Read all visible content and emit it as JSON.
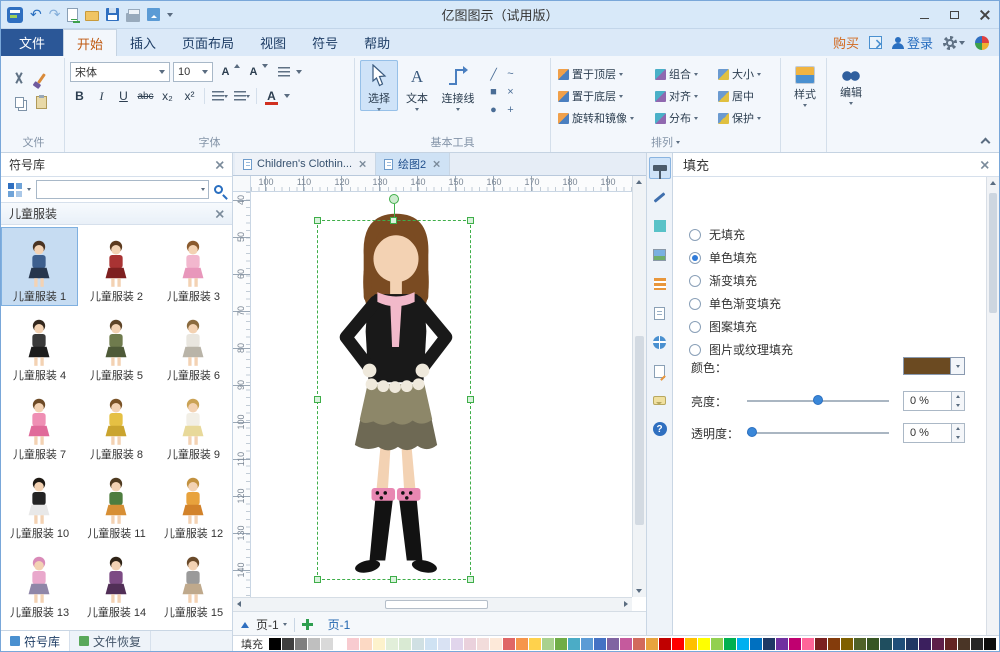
{
  "window": {
    "title": "亿图图示（试用版）"
  },
  "ribbon": {
    "file_tab": "文件",
    "tabs": [
      {
        "label": "开始",
        "active": true
      },
      {
        "label": "插入"
      },
      {
        "label": "页面布局"
      },
      {
        "label": "视图"
      },
      {
        "label": "符号"
      },
      {
        "label": "帮助"
      }
    ],
    "right": {
      "buy": "购买",
      "login": "登录"
    },
    "groups": {
      "file": {
        "label": "文件"
      },
      "font": {
        "label": "字体",
        "font_name": "宋体",
        "font_size": "10",
        "bold": "B",
        "italic": "I",
        "underline": "U",
        "strike": "abc",
        "subscript": "x₂",
        "superscript": "x²",
        "color": "A"
      },
      "tools": {
        "label": "基本工具",
        "select": "选择",
        "text": "文本",
        "connector": "连接线"
      },
      "arrange": {
        "label": "排列",
        "buttons": [
          {
            "label": "置于顶层",
            "caret": true
          },
          {
            "label": "组合",
            "caret": true
          },
          {
            "label": "大小",
            "caret": true
          },
          {
            "label": "置于底层",
            "caret": true
          },
          {
            "label": "对齐",
            "caret": true
          },
          {
            "label": "居中",
            "caret": false
          },
          {
            "label": "旋转和镜像",
            "caret": true
          },
          {
            "label": "分布",
            "caret": true
          },
          {
            "label": "保护",
            "caret": true
          }
        ]
      },
      "style": {
        "label": "样式"
      },
      "edit": {
        "label": "编辑"
      }
    }
  },
  "library": {
    "title": "符号库",
    "search_placeholder": "",
    "category": "儿童服装",
    "items": [
      {
        "label": "儿童服装 1",
        "selected": true,
        "hair": "#4a3322",
        "top": "#3d5f8e",
        "bottom": "#26364d"
      },
      {
        "label": "儿童服装 2",
        "hair": "#5d3a1e",
        "top": "#a93333",
        "bottom": "#7e2020"
      },
      {
        "label": "儿童服装 3",
        "hair": "#8a5a2e",
        "top": "#f2b7ce",
        "bottom": "#e897bb"
      },
      {
        "label": "儿童服装 4",
        "hair": "#33271d",
        "top": "#3a3a3a",
        "bottom": "#1d1d1d"
      },
      {
        "label": "儿童服装 5",
        "hair": "#5d4326",
        "top": "#6f7b4d",
        "bottom": "#4e5a38"
      },
      {
        "label": "儿童服装 6",
        "hair": "#8a6a3e",
        "top": "#e9e6df",
        "bottom": "#b9b4a8"
      },
      {
        "label": "儿童服装 7",
        "hair": "#6d4a26",
        "top": "#ef8fb4",
        "bottom": "#e06a9a"
      },
      {
        "label": "儿童服装 8",
        "hair": "#7a5226",
        "top": "#e5c043",
        "bottom": "#caa42e"
      },
      {
        "label": "儿童服装 9",
        "hair": "#caa255",
        "top": "#f2efe6",
        "bottom": "#e8d99a"
      },
      {
        "label": "儿童服装 10",
        "hair": "#1f1a14",
        "top": "#242424",
        "bottom": "#e8e8e8"
      },
      {
        "label": "儿童服装 11",
        "hair": "#4f3a20",
        "top": "#4e7d3f",
        "bottom": "#d78f35"
      },
      {
        "label": "儿童服装 12",
        "hair": "#c2913f",
        "top": "#e8a23c",
        "bottom": "#d2822a"
      },
      {
        "label": "儿童服装 13",
        "hair": "#d98ab8",
        "top": "#e9a8cc",
        "bottom": "#8f86a8"
      },
      {
        "label": "儿童服装 14",
        "hair": "#2f2316",
        "top": "#7c4a84",
        "bottom": "#512f57"
      },
      {
        "label": "儿童服装 15",
        "hair": "#6a4a2a",
        "top": "#9a9a9a",
        "bottom": "#bfa98c"
      }
    ],
    "bottom_tabs": [
      {
        "label": "符号库",
        "active": true
      },
      {
        "label": "文件恢复",
        "active": false
      }
    ]
  },
  "canvas": {
    "doc_tabs": [
      {
        "label": "Children's Clothin...",
        "active": false
      },
      {
        "label": "绘图2",
        "active": true
      }
    ],
    "ruler_h": [
      "100",
      "110",
      "120",
      "130",
      "140",
      "150",
      "160",
      "170",
      "180",
      "190"
    ],
    "ruler_v": [
      "40",
      "50",
      "60",
      "70",
      "80",
      "90",
      "100",
      "110",
      "120",
      "130",
      "140"
    ],
    "figure": {
      "hair": "#7a4b22",
      "skin": "#f3d2b3",
      "jacket": "#191919",
      "scarf": "#f2b9ca",
      "trim": "#efe9dc",
      "skirt_top": "#8d8769",
      "skirt_bottom": "#6e6954",
      "boots": "#121212",
      "boot_trim": "#e887b2",
      "selection": "#3fae49"
    },
    "page_bar": {
      "page_dropdown": "页-1",
      "page_tab": "页-1"
    }
  },
  "fill_panel": {
    "title": "填充",
    "options": [
      {
        "label": "无填充",
        "selected": false
      },
      {
        "label": "单色填充",
        "selected": true
      },
      {
        "label": "渐变填充",
        "selected": false
      },
      {
        "label": "单色渐变填充",
        "selected": false
      },
      {
        "label": "图案填充",
        "selected": false
      },
      {
        "label": "图片或纹理填充",
        "selected": false
      }
    ],
    "color_label": "颜色：",
    "color_value": "#6b4a21",
    "brightness_label": "亮度：",
    "brightness_value": "0 %",
    "transparency_label": "透明度：",
    "transparency_value": "0 %"
  },
  "statusbar": {
    "fill_label": "填充",
    "palette": [
      "#000000",
      "#3f3f3f",
      "#7f7f7f",
      "#bfbfbf",
      "#d9d9d9",
      "#ffffff",
      "#f8cbd0",
      "#fcd9c4",
      "#fdf2cc",
      "#e2efda",
      "#d9ead3",
      "#d0e0e3",
      "#cfe2f3",
      "#d9e2f3",
      "#e1d5ec",
      "#ead1dc",
      "#f2dcdb",
      "#fde9d9",
      "#e06666",
      "#f6954b",
      "#ffd24c",
      "#a9d18e",
      "#70ad47",
      "#4bacc6",
      "#5b9bd5",
      "#4472c4",
      "#8064a2",
      "#c55a9d",
      "#d26a5c",
      "#e8a33d",
      "#c00000",
      "#ff0000",
      "#ffc000",
      "#ffff00",
      "#92d050",
      "#00b050",
      "#00b0f0",
      "#0070c0",
      "#1f3864",
      "#7030a0",
      "#c00070",
      "#ff6699",
      "#7b2020",
      "#843c0c",
      "#7f6000",
      "#4f6228",
      "#375623",
      "#1f4e5f",
      "#1f4e79",
      "#203864",
      "#3b1f5e",
      "#5e1f4a",
      "#632423",
      "#4a3526",
      "#262626",
      "#0d0d0d"
    ]
  }
}
